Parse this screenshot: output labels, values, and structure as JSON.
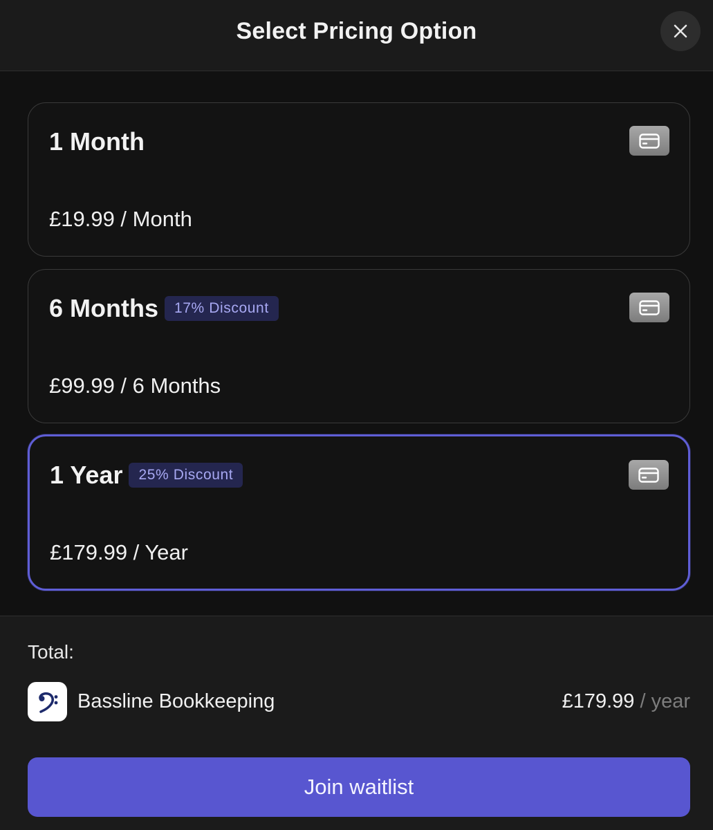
{
  "header": {
    "title": "Select Pricing Option",
    "close_icon": "close-icon"
  },
  "plans": [
    {
      "title": "1 Month",
      "discount": "",
      "price": "£19.99 / Month",
      "icon": "credit-card-icon",
      "selected": false
    },
    {
      "title": "6 Months",
      "discount": "17% Discount",
      "price": "£99.99 / 6 Months",
      "icon": "credit-card-icon",
      "selected": false
    },
    {
      "title": "1 Year",
      "discount": "25% Discount",
      "price": "£179.99 / Year",
      "icon": "credit-card-icon",
      "selected": true
    }
  ],
  "summary": {
    "total_label": "Total:",
    "product_name": "Bassline Bookkeeping",
    "product_icon": "bass-clef-icon",
    "price_amount": "£179.99",
    "price_period": " / year"
  },
  "cta": {
    "label": "Join waitlist"
  },
  "colors": {
    "accent": "#5856d0",
    "selected_border": "#5f5ed6",
    "badge_bg": "#24264f",
    "badge_text": "#a7a8f2",
    "background": "#111111",
    "panel": "#1b1b1b"
  }
}
